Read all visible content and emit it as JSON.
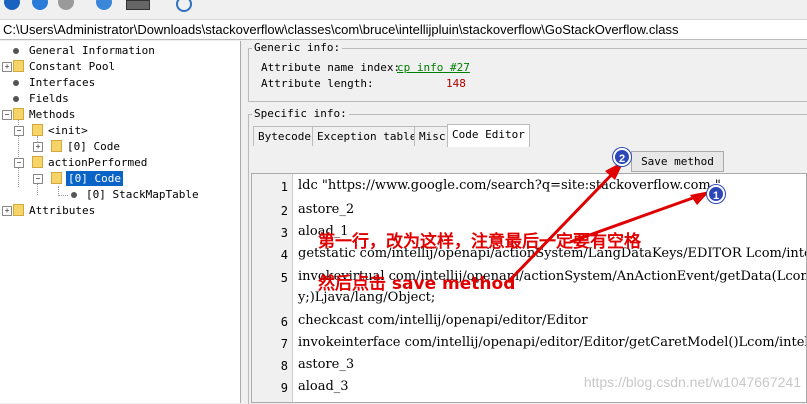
{
  "path": "C:\\Users\\Administrator\\Downloads\\stackoverflow\\classes\\com\\bruce\\intellijpluin\\stackoverflow\\GoStackOverflow.class",
  "tree": {
    "general_information": "General Information",
    "constant_pool": "Constant Pool",
    "interfaces": "Interfaces",
    "fields": "Fields",
    "methods": "Methods",
    "init": "<init>",
    "init_code": "[0] Code",
    "action_performed": "actionPerformed",
    "action_code": "[0] Code",
    "stack_map_table": "[0] StackMapTable",
    "attributes": "Attributes"
  },
  "generic_info": {
    "label": "Generic info:",
    "name_index_label": "Attribute name index:",
    "name_index_value": "cp info #27",
    "length_label": "Attribute length:",
    "length_value": "148"
  },
  "specific_info": {
    "label": "Specific info:",
    "tabs": [
      "Bytecode",
      "Exception table",
      "Misc",
      "Code Editor"
    ],
    "save_button": "Save method"
  },
  "code_lines": [
    {
      "n": "1",
      "text": "ldc \"https://www.google.com/search?q=site:stackoverflow.com \""
    },
    {
      "n": "2",
      "text": "astore_2"
    },
    {
      "n": "3",
      "text": "aload_1"
    },
    {
      "n": "4",
      "text": "getstatic com/intellij/openapi/actionSystem/LangDataKeys/EDITOR Lcom/intellij/openapi/actionSystem/DataKey;"
    },
    {
      "n": "5",
      "text": "invokevirtual com/intellij/openapi/actionSystem/AnActionEvent/getData(Lcom/intellij/openapi/actionSystem/DataKey;)Ljava/lang/Object;",
      "wrap": "y;)Ljava/lang/Object;"
    },
    {
      "n": "6",
      "text": "checkcast com/intellij/openapi/editor/Editor"
    },
    {
      "n": "7",
      "text": "invokeinterface com/intellij/openapi/editor/Editor/getCaretModel()Lcom/intellij/openapi/editor/CaretModel;"
    },
    {
      "n": "8",
      "text": "astore_3"
    },
    {
      "n": "9",
      "text": "aload_3"
    }
  ],
  "annotations": {
    "badge1": "1",
    "badge2": "2",
    "note1": "第一行，改为这样，注意最后一定要有空格",
    "note2": "然后点击 save method",
    "color": "#e00000"
  },
  "watermark": "https://blog.csdn.net/w1047667241"
}
